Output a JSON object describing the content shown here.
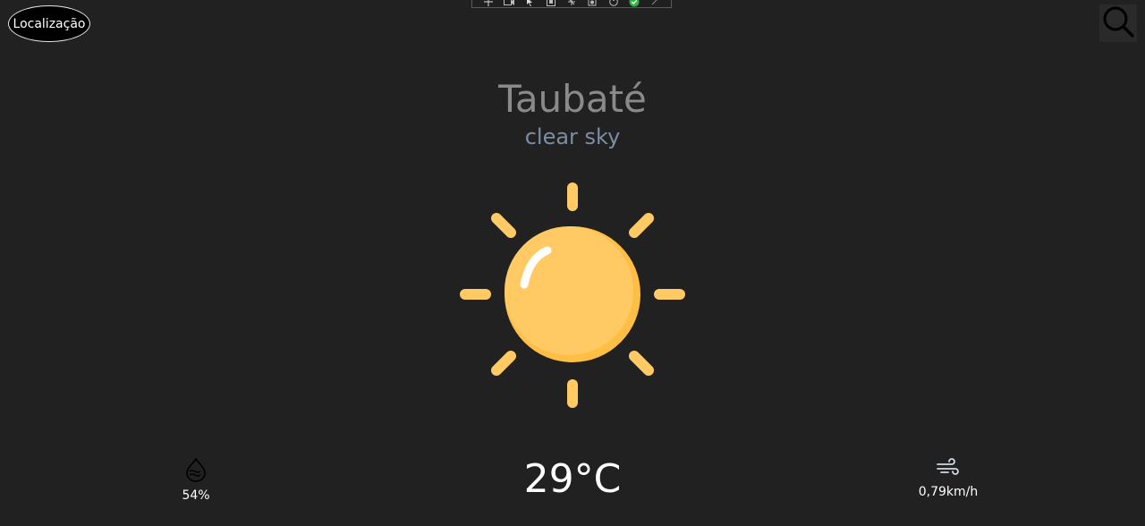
{
  "header": {
    "location_label": "Localização"
  },
  "weather": {
    "city": "Taubaté",
    "condition": "clear sky",
    "temperature": "29°C",
    "humidity": "54%",
    "wind": "0,79km/h",
    "condition_icon": "sun-icon"
  },
  "colors": {
    "background": "#212121",
    "sun": "#FFCA64",
    "sun_shade": "#FFBE44",
    "city": "#8A8A8A",
    "condition": "#7D8EA3"
  },
  "icons": {
    "search": "search-icon",
    "humidity": "humidity-drop-icon",
    "wind": "wind-icon"
  }
}
